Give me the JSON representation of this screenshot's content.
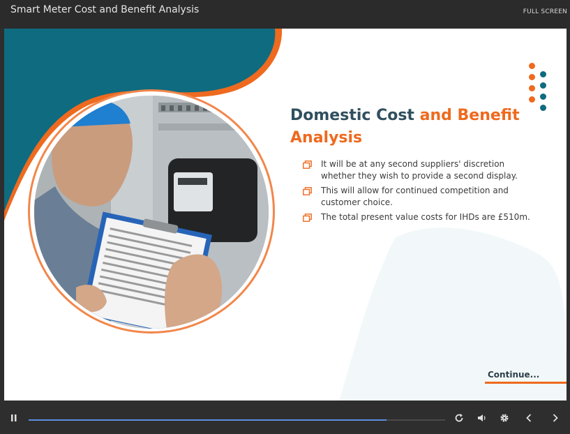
{
  "window": {
    "title": "Smart Meter Cost and Benefit Analysis",
    "fullscreen_label": "FULL SCREEN"
  },
  "slide": {
    "heading_part1": "Domestic Cost ",
    "heading_part2": "and Benefit Analysis",
    "bullets": [
      "It will be at any second suppliers' discretion whether they wish to provide a second display.",
      "This will allow for continued competition and customer choice.",
      "The total present value costs for IHDs are £510m."
    ],
    "continue_label": "Continue...",
    "image_alt": "Technician checking a smart meter with a clipboard"
  },
  "colors": {
    "teal": "#0e6b80",
    "orange": "#ee6a1f",
    "dark_text": "#2f4f5e"
  },
  "playback": {
    "progress_fraction": 0.86
  },
  "icons": [
    "pause-icon",
    "replay-icon",
    "volume-icon",
    "settings-icon",
    "previous-icon",
    "next-icon"
  ]
}
